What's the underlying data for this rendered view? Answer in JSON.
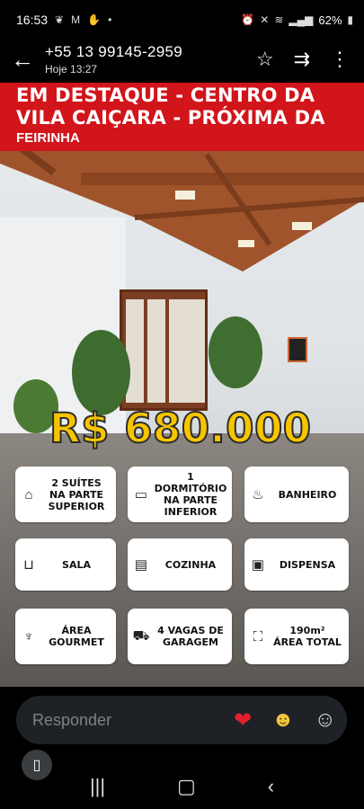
{
  "status_bar": {
    "time": "16:53",
    "notification_icons": [
      "leaf-icon",
      "gmail-icon",
      "hand-icon",
      "dot-icon"
    ],
    "system_icons": [
      "alarm-icon",
      "mute-icon",
      "wifi-icon",
      "signal-icon"
    ],
    "battery": "62%"
  },
  "chat_header": {
    "phone": "+55 13 99145-2959",
    "timestamp": "Hoje 13:27"
  },
  "story": {
    "headline_line1": "EM DESTAQUE - CENTRO DA",
    "headline_line2": "VILA CAIÇARA - PRÓXIMA DA",
    "headline_line3": "FEIRINHA",
    "price": "R$ 680.000",
    "accent_color": "#d1151b",
    "price_color": "#f7c500",
    "features": [
      {
        "icon": "house-icon",
        "label_line1": "2 SUÍTES",
        "label_line2": "NA PARTE",
        "label_line3": "SUPERIOR"
      },
      {
        "icon": "bed-icon",
        "label_line1": "1 DORMITÓRIO",
        "label_line2": "NA PARTE INFERIOR"
      },
      {
        "icon": "shower-icon",
        "label_line1": "BANHEIRO"
      },
      {
        "icon": "sofa-icon",
        "label_line1": "SALA"
      },
      {
        "icon": "stove-icon",
        "label_line1": "COZINHA"
      },
      {
        "icon": "cabinet-icon",
        "label_line1": "DISPENSA"
      },
      {
        "icon": "grill-icon",
        "label_line1": "ÁREA",
        "label_line2": "GOURMET"
      },
      {
        "icon": "car-icon",
        "label_line1": "4 VAGAS DE",
        "label_line2": "GARAGEM"
      },
      {
        "icon": "area-icon",
        "label_line1": "190m²",
        "label_line2": "ÁREA TOTAL"
      }
    ]
  },
  "reply": {
    "placeholder": "Responder",
    "reactions": [
      "heart-icon",
      "laugh-emoji-icon",
      "add-emoji-icon"
    ]
  }
}
